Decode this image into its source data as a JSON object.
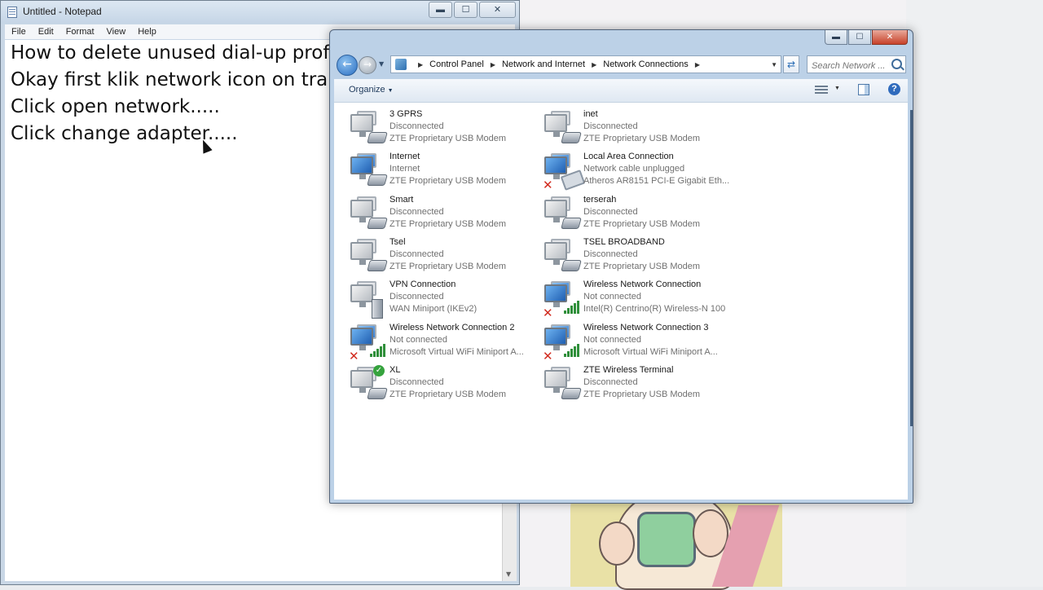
{
  "notepad": {
    "title": "Untitled - Notepad",
    "controls": {
      "minimize": "▬",
      "maximize": "☐",
      "close": "✕"
    },
    "menu": [
      "File",
      "Edit",
      "Format",
      "View",
      "Help"
    ],
    "lines": [
      "How to delete unused dial-up prof",
      "Okay first klik network icon on tra",
      "Click open network.....",
      "Click change adapter....."
    ]
  },
  "explorer": {
    "controls": {
      "minimize": "▬",
      "maximize": "☐",
      "close": "✕"
    },
    "breadcrumb": [
      "Control Panel",
      "Network and Internet",
      "Network Connections"
    ],
    "search_placeholder": "Search Network ...",
    "toolbar": {
      "organize": "Organize",
      "help": "?"
    },
    "icons": {
      "back": "back-arrow-icon",
      "forward": "forward-arrow-icon",
      "refresh": "refresh-icon",
      "search": "search-icon",
      "views": "change-view-icon",
      "preview": "preview-pane-icon",
      "help": "help-icon"
    },
    "colors": {
      "error": "#d12b1f",
      "ok": "#35a33d",
      "signal": "#2f8f3a",
      "link": "#1e395b"
    },
    "connections": [
      {
        "name": "3 GPRS",
        "status": "Disconnected",
        "device": "ZTE Proprietary USB Modem",
        "kind": "modem",
        "badge": "none"
      },
      {
        "name": "inet",
        "status": "Disconnected",
        "device": "ZTE Proprietary USB Modem",
        "kind": "modem",
        "badge": "none"
      },
      {
        "name": "Internet",
        "status": "Internet",
        "device": "ZTE Proprietary USB Modem",
        "kind": "modem",
        "badge": "connected"
      },
      {
        "name": "Local Area Connection",
        "status": "Network cable unplugged",
        "device": "Atheros AR8151 PCI-E Gigabit Eth...",
        "kind": "ethernet",
        "badge": "error"
      },
      {
        "name": "Smart",
        "status": "Disconnected",
        "device": "ZTE Proprietary USB Modem",
        "kind": "modem",
        "badge": "none"
      },
      {
        "name": "terserah",
        "status": "Disconnected",
        "device": "ZTE Proprietary USB Modem",
        "kind": "modem",
        "badge": "none"
      },
      {
        "name": "Tsel",
        "status": "Disconnected",
        "device": "ZTE Proprietary USB Modem",
        "kind": "modem",
        "badge": "none"
      },
      {
        "name": "TSEL BROADBAND",
        "status": "Disconnected",
        "device": "ZTE Proprietary USB Modem",
        "kind": "modem",
        "badge": "none"
      },
      {
        "name": "VPN Connection",
        "status": "Disconnected",
        "device": "WAN Miniport (IKEv2)",
        "kind": "vpn",
        "badge": "none"
      },
      {
        "name": "Wireless Network Connection",
        "status": "Not connected",
        "device": "Intel(R) Centrino(R) Wireless-N 100",
        "kind": "wireless",
        "badge": "error"
      },
      {
        "name": "Wireless Network Connection 2",
        "status": "Not connected",
        "device": "Microsoft Virtual WiFi Miniport A...",
        "kind": "wireless",
        "badge": "error"
      },
      {
        "name": "Wireless Network Connection 3",
        "status": "Not connected",
        "device": "Microsoft Virtual WiFi Miniport A...",
        "kind": "wireless",
        "badge": "error"
      },
      {
        "name": "XL",
        "status": "Disconnected",
        "device": "ZTE Proprietary USB Modem",
        "kind": "modem",
        "badge": "default"
      },
      {
        "name": "ZTE Wireless Terminal",
        "status": "Disconnected",
        "device": "ZTE Proprietary USB Modem",
        "kind": "modem",
        "badge": "none"
      }
    ]
  }
}
